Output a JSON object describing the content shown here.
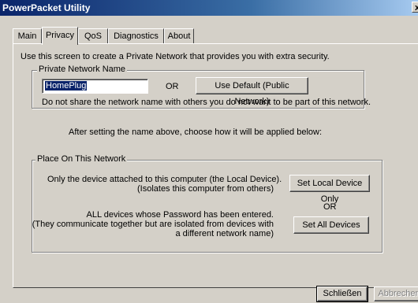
{
  "window": {
    "title": "PowerPacket Utility",
    "close": "x"
  },
  "tabs": [
    {
      "label": "Main"
    },
    {
      "label": "Privacy"
    },
    {
      "label": "QoS"
    },
    {
      "label": "Diagnostics"
    },
    {
      "label": "About"
    }
  ],
  "privacy": {
    "intro": "Use this screen to create a Private Network that provides you with extra security.",
    "network_group_label": "Private Network Name",
    "network_name_value": "HomePlug",
    "or_label": "OR",
    "default_button": "Use Default (Public Network)",
    "share_warning": "Do not share the network name with others you do not want to be part of this network.",
    "after_setting": "After setting the name above, choose how it will be applied below:",
    "place_group_label": "Place On This Network",
    "local_line1": "Only the device attached to this computer (the Local Device).",
    "local_line2": "(Isolates this computer from others)",
    "local_button": "Set Local Device Only",
    "or_label_2": "OR",
    "all_line1": "ALL devices whose Password has been entered.",
    "all_line2": "(They communicate together but are isolated from devices with",
    "all_line3": "a different network name)",
    "all_button": "Set All Devices"
  },
  "footer": {
    "close_button": "Schließen",
    "cancel_button": "Abbrechen"
  }
}
